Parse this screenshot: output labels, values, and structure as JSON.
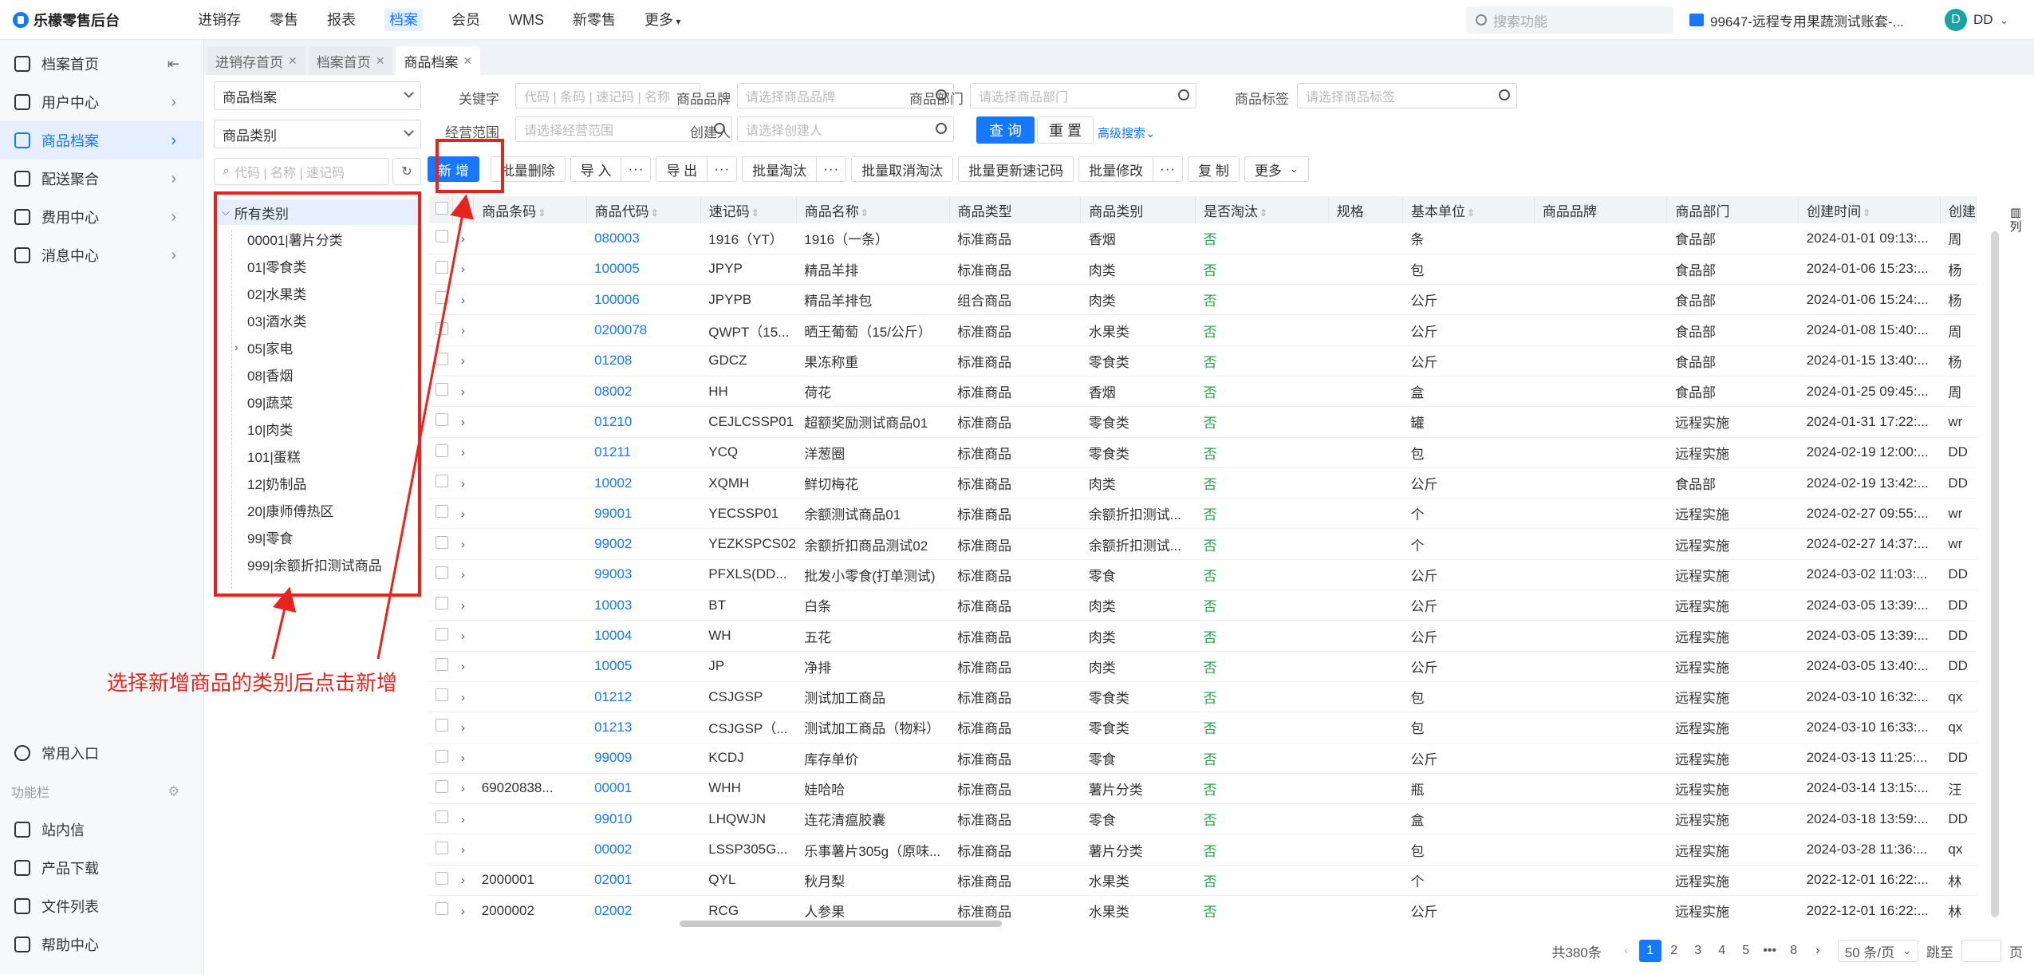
{
  "app": {
    "title": "乐檬零售后台"
  },
  "topnav": [
    "进销存",
    "零售",
    "报表",
    "档案",
    "会员",
    "WMS",
    "新零售",
    "更多"
  ],
  "topnav_active": 3,
  "search": {
    "placeholder": "搜索功能"
  },
  "account": {
    "label": "99647-远程专用果蔬测试账套-..."
  },
  "user": {
    "initial": "D",
    "name": "DD"
  },
  "sidebar": {
    "items": [
      {
        "label": "档案首页",
        "icon": "home-icon"
      },
      {
        "label": "用户中心",
        "icon": "user-icon"
      },
      {
        "label": "商品档案",
        "icon": "box-icon",
        "active": true
      },
      {
        "label": "配送聚合",
        "icon": "truck-icon"
      },
      {
        "label": "费用中心",
        "icon": "coin-icon"
      },
      {
        "label": "消息中心",
        "icon": "bell-icon"
      }
    ],
    "bottom": [
      {
        "label": "常用入口",
        "icon": "heart-icon"
      },
      {
        "label": "功能栏",
        "icon": "gear-icon",
        "muted": true
      },
      {
        "label": "站内信",
        "icon": "mail-icon"
      },
      {
        "label": "产品下载",
        "icon": "download-icon"
      },
      {
        "label": "文件列表",
        "icon": "file-icon"
      },
      {
        "label": "帮助中心",
        "icon": "help-icon"
      }
    ]
  },
  "tabs": [
    {
      "label": "进销存首页"
    },
    {
      "label": "档案首页"
    },
    {
      "label": "商品档案",
      "active": true
    }
  ],
  "left_panel": {
    "select1": "商品档案",
    "select2": "商品类别",
    "search_placeholder": "代码 | 名称 | 速记码",
    "tree_root": "所有类别",
    "tree_nodes": [
      "00001|薯片分类",
      "01|零食类",
      "02|水果类",
      "03|酒水类",
      "05|家电",
      "08|香烟",
      "09|蔬菜",
      "10|肉类",
      "101|蛋糕",
      "12|奶制品",
      "20|康师傅热区",
      "99|零食",
      "999|余额折扣测试商品"
    ]
  },
  "filters": {
    "keyword_label": "关键字",
    "keyword_placeholder": "代码 | 条码 | 速记码 | 名称",
    "brand_label": "商品品牌",
    "brand_placeholder": "请选择商品品牌",
    "dept_label": "商品部门",
    "dept_placeholder": "请选择商品部门",
    "tag_label": "商品标签",
    "tag_placeholder": "请选择商品标签",
    "scope_label": "经营范围",
    "scope_placeholder": "请选择经营范围",
    "creator_label": "创建人",
    "creator_placeholder": "请选择创建人",
    "query": "查 询",
    "reset": "重 置",
    "advanced": "高级搜索"
  },
  "toolbar": {
    "add": "新 增",
    "batch_delete": "批量删除",
    "import": "导 入",
    "export": "导 出",
    "batch_obsolete": "批量淘汰",
    "batch_cancel_obsolete": "批量取消淘汰",
    "batch_update_code": "批量更新速记码",
    "batch_modify": "批量修改",
    "copy": "复 制",
    "more": "更多",
    "ellipsis": "···"
  },
  "table": {
    "columns": [
      "商品条码",
      "商品代码",
      "速记码",
      "商品名称",
      "商品类型",
      "商品类别",
      "是否淘汰",
      "规格",
      "基本单位",
      "商品品牌",
      "商品部门",
      "创建时间",
      "创建"
    ],
    "rows": [
      [
        "",
        "080003",
        "1916（YT）",
        "1916（一条）",
        "标准商品",
        "香烟",
        "否",
        "",
        "条",
        "",
        "食品部",
        "2024-01-01 09:13:...",
        "周"
      ],
      [
        "",
        "100005",
        "JPYP",
        "精品羊排",
        "标准商品",
        "肉类",
        "否",
        "",
        "包",
        "",
        "食品部",
        "2024-01-06 15:23:...",
        "杨"
      ],
      [
        "",
        "100006",
        "JPYPB",
        "精品羊排包",
        "组合商品",
        "肉类",
        "否",
        "",
        "公斤",
        "",
        "食品部",
        "2024-01-06 15:24:...",
        "杨"
      ],
      [
        "",
        "0200078",
        "QWPT（15...",
        "晒王葡萄（15/公斤）",
        "标准商品",
        "水果类",
        "否",
        "",
        "公斤",
        "",
        "食品部",
        "2024-01-08 15:40:...",
        "周"
      ],
      [
        "",
        "01208",
        "GDCZ",
        "果冻称重",
        "标准商品",
        "零食类",
        "否",
        "",
        "公斤",
        "",
        "食品部",
        "2024-01-15 13:40:...",
        "杨"
      ],
      [
        "",
        "08002",
        "HH",
        "荷花",
        "标准商品",
        "香烟",
        "否",
        "",
        "盒",
        "",
        "食品部",
        "2024-01-25 09:45:...",
        "周"
      ],
      [
        "",
        "01210",
        "CEJLCSSP01",
        "超额奖励测试商品01",
        "标准商品",
        "零食类",
        "否",
        "",
        "罐",
        "",
        "远程实施",
        "2024-01-31 17:22:...",
        "wr"
      ],
      [
        "",
        "01211",
        "YCQ",
        "洋葱圈",
        "标准商品",
        "零食类",
        "否",
        "",
        "包",
        "",
        "远程实施",
        "2024-02-19 12:00:...",
        "DD"
      ],
      [
        "",
        "10002",
        "XQMH",
        "鲜切梅花",
        "标准商品",
        "肉类",
        "否",
        "",
        "公斤",
        "",
        "食品部",
        "2024-02-19 13:42:...",
        "DD"
      ],
      [
        "",
        "99001",
        "YECSSP01",
        "余额测试商品01",
        "标准商品",
        "余额折扣测试...",
        "否",
        "",
        "个",
        "",
        "远程实施",
        "2024-02-27 09:55:...",
        "wr"
      ],
      [
        "",
        "99002",
        "YEZKSPCS02",
        "余额折扣商品测试02",
        "标准商品",
        "余额折扣测试...",
        "否",
        "",
        "个",
        "",
        "远程实施",
        "2024-02-27 14:37:...",
        "wr"
      ],
      [
        "",
        "99003",
        "PFXLS(DD...",
        "批发小零食(打单测试)",
        "标准商品",
        "零食",
        "否",
        "",
        "公斤",
        "",
        "远程实施",
        "2024-03-02 11:03:...",
        "DD"
      ],
      [
        "",
        "10003",
        "BT",
        "白条",
        "标准商品",
        "肉类",
        "否",
        "",
        "公斤",
        "",
        "远程实施",
        "2024-03-05 13:39:...",
        "DD"
      ],
      [
        "",
        "10004",
        "WH",
        "五花",
        "标准商品",
        "肉类",
        "否",
        "",
        "公斤",
        "",
        "远程实施",
        "2024-03-05 13:39:...",
        "DD"
      ],
      [
        "",
        "10005",
        "JP",
        "净排",
        "标准商品",
        "肉类",
        "否",
        "",
        "公斤",
        "",
        "远程实施",
        "2024-03-05 13:40:...",
        "DD"
      ],
      [
        "",
        "01212",
        "CSJGSP",
        "测试加工商品",
        "标准商品",
        "零食类",
        "否",
        "",
        "包",
        "",
        "远程实施",
        "2024-03-10 16:32:...",
        "qx"
      ],
      [
        "",
        "01213",
        "CSJGSP（...",
        "测试加工商品（物料）",
        "标准商品",
        "零食类",
        "否",
        "",
        "包",
        "",
        "远程实施",
        "2024-03-10 16:33:...",
        "qx"
      ],
      [
        "",
        "99009",
        "KCDJ",
        "库存单价",
        "标准商品",
        "零食",
        "否",
        "",
        "公斤",
        "",
        "远程实施",
        "2024-03-13 11:25:...",
        "DD"
      ],
      [
        "69020838...",
        "00001",
        "WHH",
        "娃哈哈",
        "标准商品",
        "薯片分类",
        "否",
        "",
        "瓶",
        "",
        "远程实施",
        "2024-03-14 13:15:...",
        "汪"
      ],
      [
        "",
        "99010",
        "LHQWJN",
        "连花清瘟胶囊",
        "标准商品",
        "零食",
        "否",
        "",
        "盒",
        "",
        "远程实施",
        "2024-03-18 13:59:...",
        "DD"
      ],
      [
        "",
        "00002",
        "LSSP305G...",
        "乐事薯片305g（原味...",
        "标准商品",
        "薯片分类",
        "否",
        "",
        "包",
        "",
        "远程实施",
        "2024-03-28 11:36:...",
        "qx"
      ],
      [
        "2000001",
        "02001",
        "QYL",
        "秋月梨",
        "标准商品",
        "水果类",
        "否",
        "",
        "个",
        "",
        "远程实施",
        "2022-12-01 16:22:...",
        "林"
      ],
      [
        "2000002",
        "02002",
        "RCG",
        "人参果",
        "标准商品",
        "水果类",
        "否",
        "",
        "公斤",
        "",
        "远程实施",
        "2022-12-01 16:22:...",
        "林"
      ]
    ]
  },
  "column_setting": "列",
  "pagination": {
    "total": "共380条",
    "pages": [
      "1",
      "2",
      "3",
      "4",
      "5",
      "•••",
      "8"
    ],
    "page_size": "50 条/页",
    "jump_label": "跳至",
    "page_unit": "页"
  },
  "annotation": "选择新增商品的类别后点击新增"
}
